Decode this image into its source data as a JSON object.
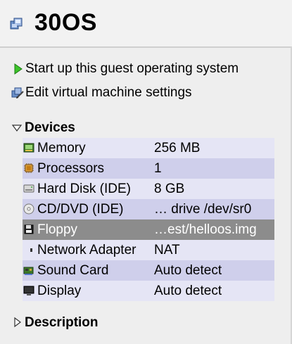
{
  "header": {
    "title": "30OS",
    "icon": "virtual-machine-icon"
  },
  "actions": {
    "start": {
      "label": "Start up this guest operating system",
      "icon": "play-arrow-icon"
    },
    "edit": {
      "label": "Edit virtual machine settings",
      "icon": "edit-settings-icon"
    }
  },
  "devices": {
    "heading": "Devices",
    "items": [
      {
        "name": "Memory",
        "value": "256 MB",
        "icon": "memory-chip-icon"
      },
      {
        "name": "Processors",
        "value": "1",
        "icon": "processor-icon"
      },
      {
        "name": "Hard Disk (IDE)",
        "value": "8 GB",
        "icon": "hard-disk-icon"
      },
      {
        "name": "CD/DVD (IDE)",
        "value": "… drive /dev/sr0",
        "icon": "cd-dvd-icon"
      },
      {
        "name": "Floppy",
        "value": "…est/helloos.img",
        "icon": "floppy-icon",
        "selected": true
      },
      {
        "name": "Network Adapter",
        "value": "NAT",
        "icon": "network-adapter-icon"
      },
      {
        "name": "Sound Card",
        "value": "Auto detect",
        "icon": "sound-card-icon"
      },
      {
        "name": "Display",
        "value": "Auto detect",
        "icon": "display-icon"
      }
    ]
  },
  "description": {
    "heading": "Description"
  },
  "colors": {
    "row_light": "#e5e5f5",
    "row_dark": "#cfcfeb",
    "row_selected": "#8c8c8c",
    "play_green": "#2a9a1c"
  }
}
